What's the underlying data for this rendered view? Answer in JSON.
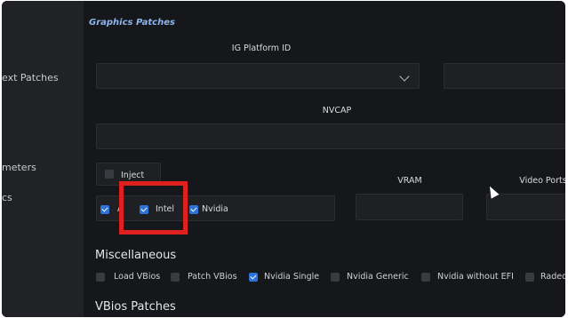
{
  "sidebar": {
    "items": [
      {
        "label": "ext Patches"
      },
      {
        "label": "meters"
      },
      {
        "label": "cs"
      }
    ]
  },
  "graphics": {
    "title": "Graphics Patches",
    "ig_platform_label": "IG Platform ID",
    "ig_platform_value": "",
    "nvcap_label": "NVCAP",
    "nvcap_value": "",
    "vram_label": "VRAM",
    "video_ports_label": "Video Ports",
    "inject_label": "Inject",
    "inject_checked": false,
    "gpu_options": [
      {
        "label": "A",
        "checked": true
      },
      {
        "label": "Intel",
        "checked": true
      },
      {
        "label": "Nvidia",
        "checked": true
      }
    ]
  },
  "misc": {
    "title": "Miscellaneous",
    "options": [
      {
        "label": "Load VBios",
        "checked": false
      },
      {
        "label": "Patch VBios",
        "checked": false
      },
      {
        "label": "Nvidia Single",
        "checked": true
      },
      {
        "label": "Nvidia Generic",
        "checked": false
      },
      {
        "label": "Nvidia without EFI",
        "checked": false
      },
      {
        "label": "Radeo",
        "checked": false
      }
    ]
  },
  "vbios": {
    "title": "VBios Patches"
  },
  "colors": {
    "accent": "#2b73d9",
    "section_title": "#8eb5ec",
    "highlight_box": "#e0201e",
    "background": "#16171b",
    "sidebar": "#202225"
  }
}
